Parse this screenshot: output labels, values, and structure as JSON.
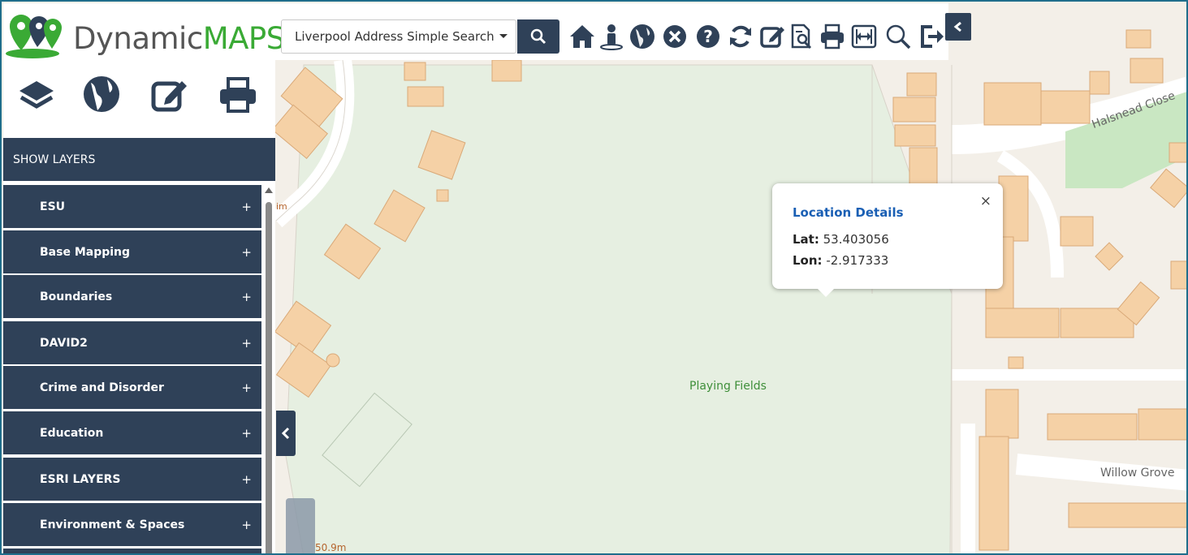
{
  "app": {
    "brand_part1": "Dynamic",
    "brand_part2": "MAPS"
  },
  "search": {
    "selected": "Liverpool Address Simple Search"
  },
  "toolbar": {
    "icons": [
      "home-icon",
      "person-icon",
      "globe-icon",
      "close-circle-icon",
      "help-icon",
      "refresh-icon",
      "edit-icon",
      "document-search-icon",
      "print-icon",
      "fit-extent-icon",
      "zoom-icon",
      "logout-icon"
    ]
  },
  "sidebar": {
    "tools": [
      "layers-icon",
      "globe-icon",
      "edit-icon",
      "print-icon"
    ],
    "header": "SHOW LAYERS",
    "layers": [
      {
        "label": "ESU",
        "toggle": "+"
      },
      {
        "label": "Base Mapping",
        "toggle": "+"
      },
      {
        "label": "Boundaries",
        "toggle": "+"
      },
      {
        "label": "DAVID2",
        "toggle": "+"
      },
      {
        "label": "Crime and Disorder",
        "toggle": "+"
      },
      {
        "label": "Education",
        "toggle": "+"
      },
      {
        "label": "ESRI LAYERS",
        "toggle": "+"
      },
      {
        "label": "Environment & Spaces",
        "toggle": "+"
      }
    ]
  },
  "map": {
    "labels": {
      "playing_fields": "Playing Fields",
      "halsnead_close": "Halsnead Close",
      "willow_grove": "Willow Grove",
      "scale": "50.9m",
      "edge_label": "im"
    }
  },
  "popup": {
    "title": "Location Details",
    "close": "×",
    "lat_label": "Lat:",
    "lat_value": "53.403056",
    "lon_label": "Lon:",
    "lon_value": "-2.917333"
  },
  "colors": {
    "navy": "#2f4158",
    "brand_green": "#3aaa35",
    "popup_title": "#1a5fb4",
    "building": "#f5d1a6",
    "park": "#e6efe1"
  }
}
